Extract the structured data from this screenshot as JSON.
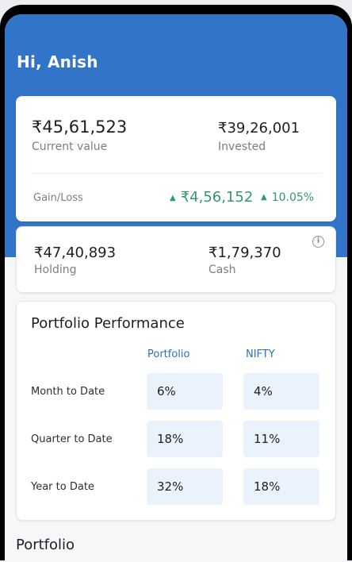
{
  "header": {
    "greeting": "Hi, Anish"
  },
  "summary": {
    "current_value": "₹45,61,523",
    "current_value_label": "Current value",
    "invested": "₹39,26,001",
    "invested_label": "Invested",
    "gain_loss_label": "Gain/Loss",
    "gain_amount": "₹4,56,152",
    "gain_percent": "10.05%",
    "gain_color": "#2f9a68"
  },
  "breakdown": {
    "holding": "₹47,40,893",
    "holding_label": "Holding",
    "cash": "₹1,79,370",
    "cash_label": "Cash",
    "info_icon": "i"
  },
  "performance": {
    "title": "Portfolio Performance",
    "columns": [
      "Portfolio",
      "NIFTY"
    ],
    "rows": [
      {
        "label": "Month to Date",
        "portfolio": "6%",
        "nifty": "4%"
      },
      {
        "label": "Quarter to Date",
        "portfolio": "18%",
        "nifty": "11%"
      },
      {
        "label": "Year to Date",
        "portfolio": "32%",
        "nifty": "18%"
      }
    ]
  },
  "next_section": {
    "title": "Portfolio"
  },
  "colors": {
    "header_blue": "#3174c8",
    "accent_blue": "#2a73b8",
    "cell_bg": "#eaf3fb"
  }
}
